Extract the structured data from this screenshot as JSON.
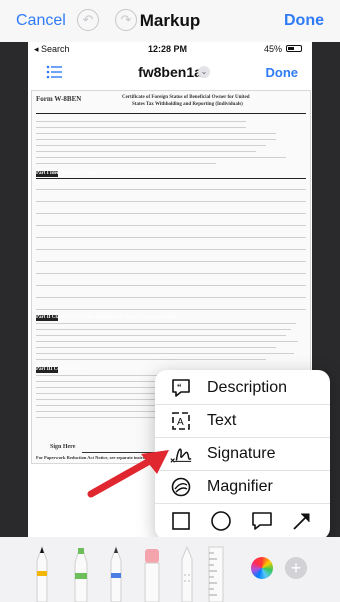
{
  "markup_bar": {
    "cancel_label": "Cancel",
    "title": "Markup",
    "done_label": "Done",
    "undo_icon": "undo-icon",
    "redo_icon": "redo-icon"
  },
  "inner_status": {
    "back_label": "◂ Search",
    "time": "12:28 PM",
    "battery": "45%"
  },
  "inner_toolbar": {
    "title": "fw8ben1a",
    "done_label": "Done"
  },
  "document": {
    "form_id": "Form W-8BEN",
    "heading_1": "Certificate of Foreign Status of Beneficial Owner for United",
    "heading_2": "States Tax Withholding and Reporting (Individuals)",
    "part1": "Part I   Identification of Beneficial Owner (see instructions)",
    "part2": "Part II  Claim of Tax Treaty Benefits (for chapter 3 purposes only)",
    "part3": "Part III  Certification",
    "sign_here": "Sign Here",
    "footer": "For Paperwork Reduction Act Notice, see separate instructions."
  },
  "annotation_menu": {
    "items": [
      {
        "label": "Description",
        "icon": "quote-bubble-icon"
      },
      {
        "label": "Text",
        "icon": "text-box-icon"
      },
      {
        "label": "Signature",
        "icon": "signature-icon"
      },
      {
        "label": "Magnifier",
        "icon": "magnifier-icon"
      }
    ],
    "shapes": [
      "square-icon",
      "circle-icon",
      "speech-bubble-icon",
      "arrow-icon"
    ]
  },
  "tools": {
    "items": [
      "pen-icon",
      "marker-icon",
      "pencil-icon",
      "eraser-icon",
      "lasso-icon",
      "ruler-icon",
      "color-wheel-icon",
      "plus-icon"
    ]
  },
  "colors": {
    "accent": "#2f7bf6",
    "arrow": "#e0262e"
  }
}
